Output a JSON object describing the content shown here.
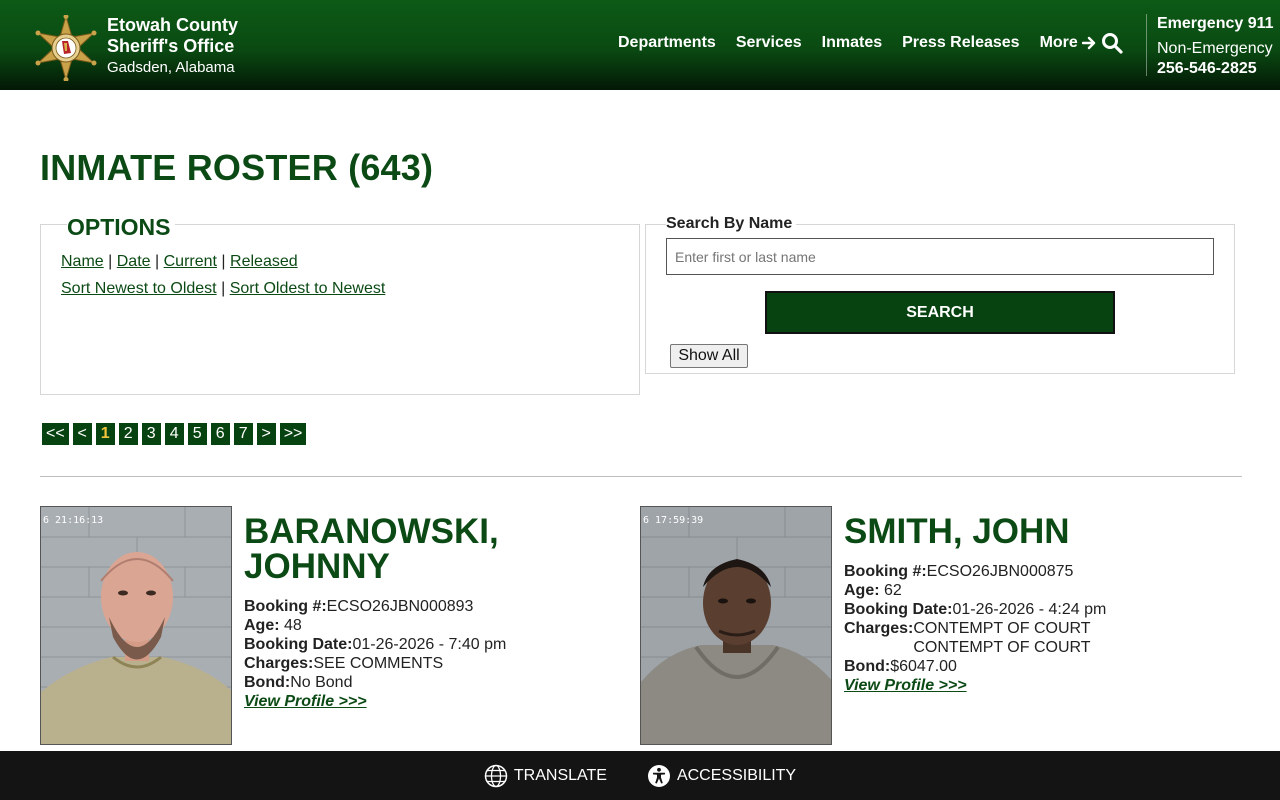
{
  "header": {
    "brand_line1": "Etowah County",
    "brand_line2": "Sheriff's Office",
    "brand_line3": "Gadsden, Alabama",
    "nav": [
      "Departments",
      "Services",
      "Inmates",
      "Press Releases",
      "More"
    ],
    "emergency": "Emergency 911",
    "non_emergency_label": "Non-Emergency",
    "non_emergency_phone": "256-546-2825",
    "colors": {
      "header_green": "#0a4a12",
      "badge_gold": "#c9a24a"
    }
  },
  "page": {
    "title": "INMATE ROSTER (643)"
  },
  "options": {
    "title": "OPTIONS",
    "row1": [
      "Name",
      "Date",
      "Current",
      "Released"
    ],
    "row2": [
      "Sort Newest to Oldest",
      "Sort Oldest to Newest"
    ],
    "separator": "|"
  },
  "search": {
    "label": "Search By Name",
    "placeholder": "Enter first or last name",
    "button": "SEARCH",
    "show_all": "Show All"
  },
  "pagination": {
    "first": "<<",
    "prev": "<",
    "pages": [
      "1",
      "2",
      "3",
      "4",
      "5",
      "6",
      "7"
    ],
    "current": "1",
    "next": ">",
    "last": ">>"
  },
  "inmates": [
    {
      "name": "BARANOWSKI, JOHNNY",
      "booking_label": "Booking #:",
      "booking": "ECSO26JBN000893",
      "age_label": "Age:",
      "age": "48",
      "booking_date_label": "Booking Date:",
      "booking_date": "01-26-2026 - 7:40 pm",
      "charges_label": "Charges:",
      "charges": [
        "SEE COMMENTS"
      ],
      "bond_label": "Bond:",
      "bond": "No Bond",
      "profile_link": "View Profile >>>",
      "photo_stamp": "6  21:16:13"
    },
    {
      "name": "SMITH, JOHN",
      "booking_label": "Booking #:",
      "booking": "ECSO26JBN000875",
      "age_label": "Age:",
      "age": "62",
      "booking_date_label": "Booking Date:",
      "booking_date": "01-26-2026 - 4:24 pm",
      "charges_label": "Charges:",
      "charges": [
        "CONTEMPT OF COURT",
        "CONTEMPT OF COURT"
      ],
      "bond_label": "Bond:",
      "bond": "$6047.00",
      "profile_link": "View Profile >>>",
      "photo_stamp": "6  17:59:39"
    }
  ],
  "footer": {
    "translate": "TRANSLATE",
    "accessibility": "ACCESSIBILITY"
  }
}
